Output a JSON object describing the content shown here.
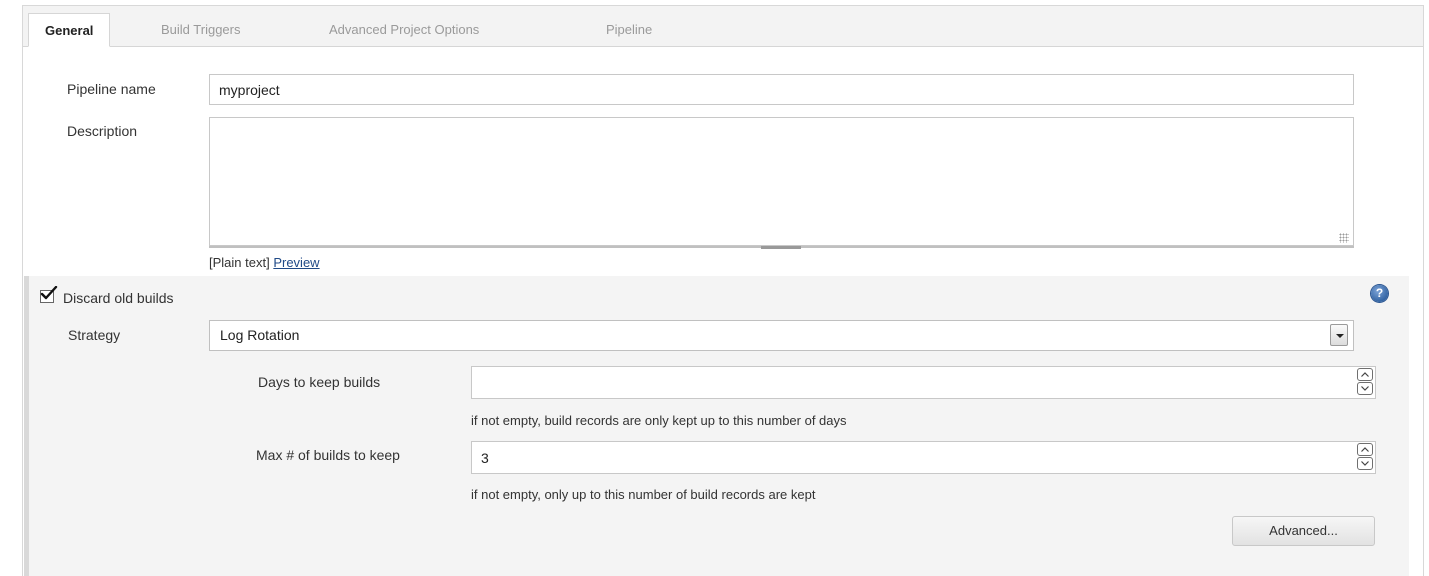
{
  "tabs": [
    {
      "label": "General",
      "active": true
    },
    {
      "label": "Build Triggers",
      "active": false
    },
    {
      "label": "Advanced Project Options",
      "active": false
    },
    {
      "label": "Pipeline",
      "active": false
    }
  ],
  "general": {
    "pipeline_name_label": "Pipeline name",
    "pipeline_name_value": "myproject",
    "description_label": "Description",
    "description_value": "",
    "format_label": "[Plain text]",
    "preview_link": "Preview"
  },
  "discard": {
    "checkbox_label": "Discard old builds",
    "checked": true,
    "help_icon": "question-help-icon",
    "strategy_label": "Strategy",
    "strategy_value": "Log Rotation",
    "days_label": "Days to keep builds",
    "days_value": "",
    "days_hint": "if not empty, build records are only kept up to this number of days",
    "max_label": "Max # of builds to keep",
    "max_value": "3",
    "max_hint": "if not empty, only up to this number of build records are kept",
    "advanced_button": "Advanced..."
  },
  "colors": {
    "link": "#204a87",
    "help_icon": "#3465a4",
    "tab_bar": "#f3f3f3",
    "section_bg": "#f4f4f4"
  }
}
